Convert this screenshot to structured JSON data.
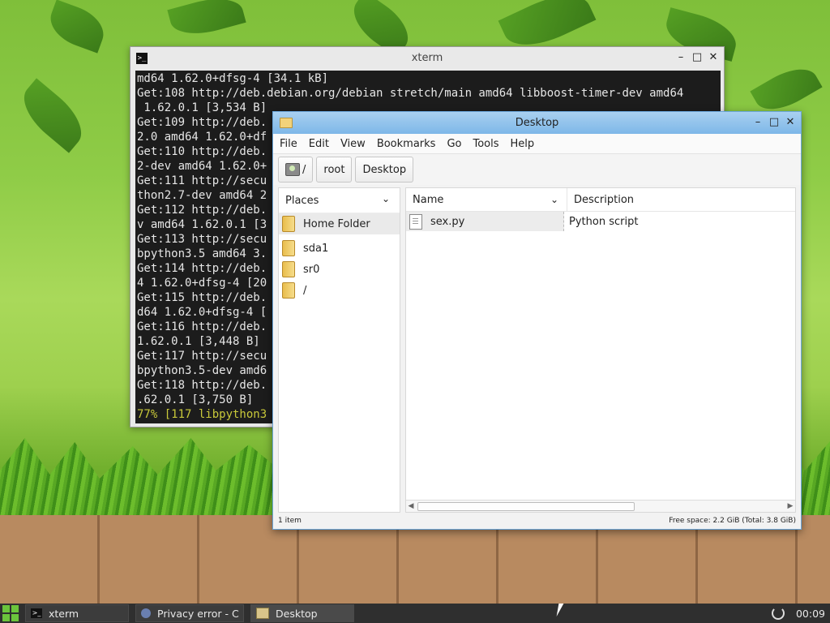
{
  "xterm": {
    "title": "xterm",
    "lines": [
      "md64 1.62.0+dfsg-4 [34.1 kB]",
      "Get:108 http://deb.debian.org/debian stretch/main amd64 libboost-timer-dev amd64",
      " 1.62.0.1 [3,534 B]",
      "Get:109 http://deb.",
      "2.0 amd64 1.62.0+df",
      "Get:110 http://deb.",
      "2-dev amd64 1.62.0+",
      "Get:111 http://secu",
      "thon2.7-dev amd64 2",
      "Get:112 http://deb.",
      "v amd64 1.62.0.1 [3",
      "Get:113 http://secu",
      "bpython3.5 amd64 3.",
      "Get:114 http://deb.",
      "4 1.62.0+dfsg-4 [20",
      "Get:115 http://deb.",
      "d64 1.62.0+dfsg-4 [",
      "Get:116 http://deb.",
      "1.62.0.1 [3,448 B]",
      "Get:117 http://secu",
      "bpython3.5-dev amd6",
      "Get:118 http://deb.",
      ".62.0.1 [3,750 B]"
    ],
    "progress_line": "77% [117 libpython3"
  },
  "filemanager": {
    "title": "Desktop",
    "menu": [
      "File",
      "Edit",
      "View",
      "Bookmarks",
      "Go",
      "Tools",
      "Help"
    ],
    "path": {
      "root_label": "/",
      "segments": [
        "root",
        "Desktop"
      ]
    },
    "places_label": "Places",
    "places": [
      {
        "label": "Home Folder",
        "selected": true
      },
      {
        "label": "sda1"
      },
      {
        "label": "sr0"
      },
      {
        "label": "/"
      }
    ],
    "columns": {
      "name": "Name",
      "description": "Description"
    },
    "files": [
      {
        "name": "sex.py",
        "description": "Python script"
      }
    ],
    "status_left": "1 item",
    "status_right": "Free space: 2.2 GiB (Total: 3.8 GiB)"
  },
  "taskbar": {
    "tasks": [
      "xterm",
      "Privacy error - C",
      "Desktop"
    ],
    "clock": "00:09"
  },
  "colors": {
    "accent_blue": "#7db7e8",
    "terminal_bg": "#1c1c1c",
    "start_green": "#6bc43c"
  }
}
